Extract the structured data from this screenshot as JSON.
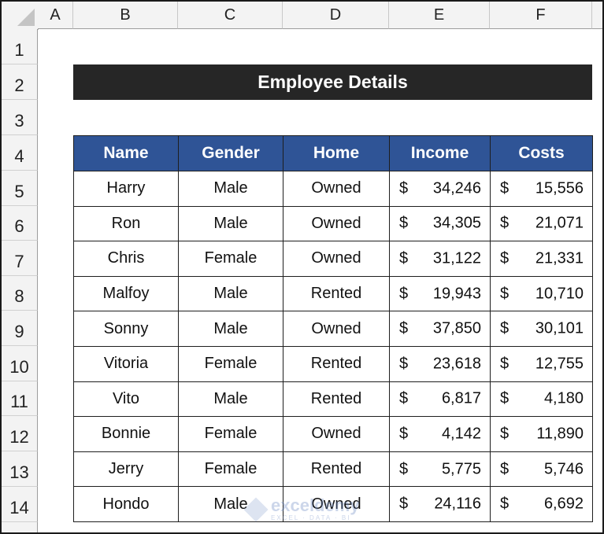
{
  "sheet": {
    "column_headers": [
      "A",
      "B",
      "C",
      "D",
      "E",
      "F"
    ],
    "row_headers": [
      "1",
      "2",
      "3",
      "4",
      "5",
      "6",
      "7",
      "8",
      "9",
      "10",
      "11",
      "12",
      "13",
      "14"
    ]
  },
  "title": "Employee Details",
  "table": {
    "headers": [
      "Name",
      "Gender",
      "Home",
      "Income",
      "Costs"
    ],
    "currency_symbol": "$",
    "rows": [
      {
        "name": "Harry",
        "gender": "Male",
        "home": "Owned",
        "income": "34,246",
        "costs": "15,556"
      },
      {
        "name": "Ron",
        "gender": "Male",
        "home": "Owned",
        "income": "34,305",
        "costs": "21,071"
      },
      {
        "name": "Chris",
        "gender": "Female",
        "home": "Owned",
        "income": "31,122",
        "costs": "21,331"
      },
      {
        "name": "Malfoy",
        "gender": "Male",
        "home": "Rented",
        "income": "19,943",
        "costs": "10,710"
      },
      {
        "name": "Sonny",
        "gender": "Male",
        "home": "Owned",
        "income": "37,850",
        "costs": "30,101"
      },
      {
        "name": "Vitoria",
        "gender": "Female",
        "home": "Rented",
        "income": "23,618",
        "costs": "12,755"
      },
      {
        "name": "Vito",
        "gender": "Male",
        "home": "Rented",
        "income": "6,817",
        "costs": "4,180"
      },
      {
        "name": "Bonnie",
        "gender": "Female",
        "home": "Owned",
        "income": "4,142",
        "costs": "11,890"
      },
      {
        "name": "Jerry",
        "gender": "Female",
        "home": "Rented",
        "income": "5,775",
        "costs": "5,746"
      },
      {
        "name": "Hondo",
        "gender": "Male",
        "home": "Owned",
        "income": "24,116",
        "costs": "6,692"
      }
    ]
  },
  "colors": {
    "header_fill": "#2f5496",
    "title_fill": "#262626"
  },
  "watermark": {
    "text": "exceldemy",
    "subtext": "EXCEL · DATA · BI"
  }
}
